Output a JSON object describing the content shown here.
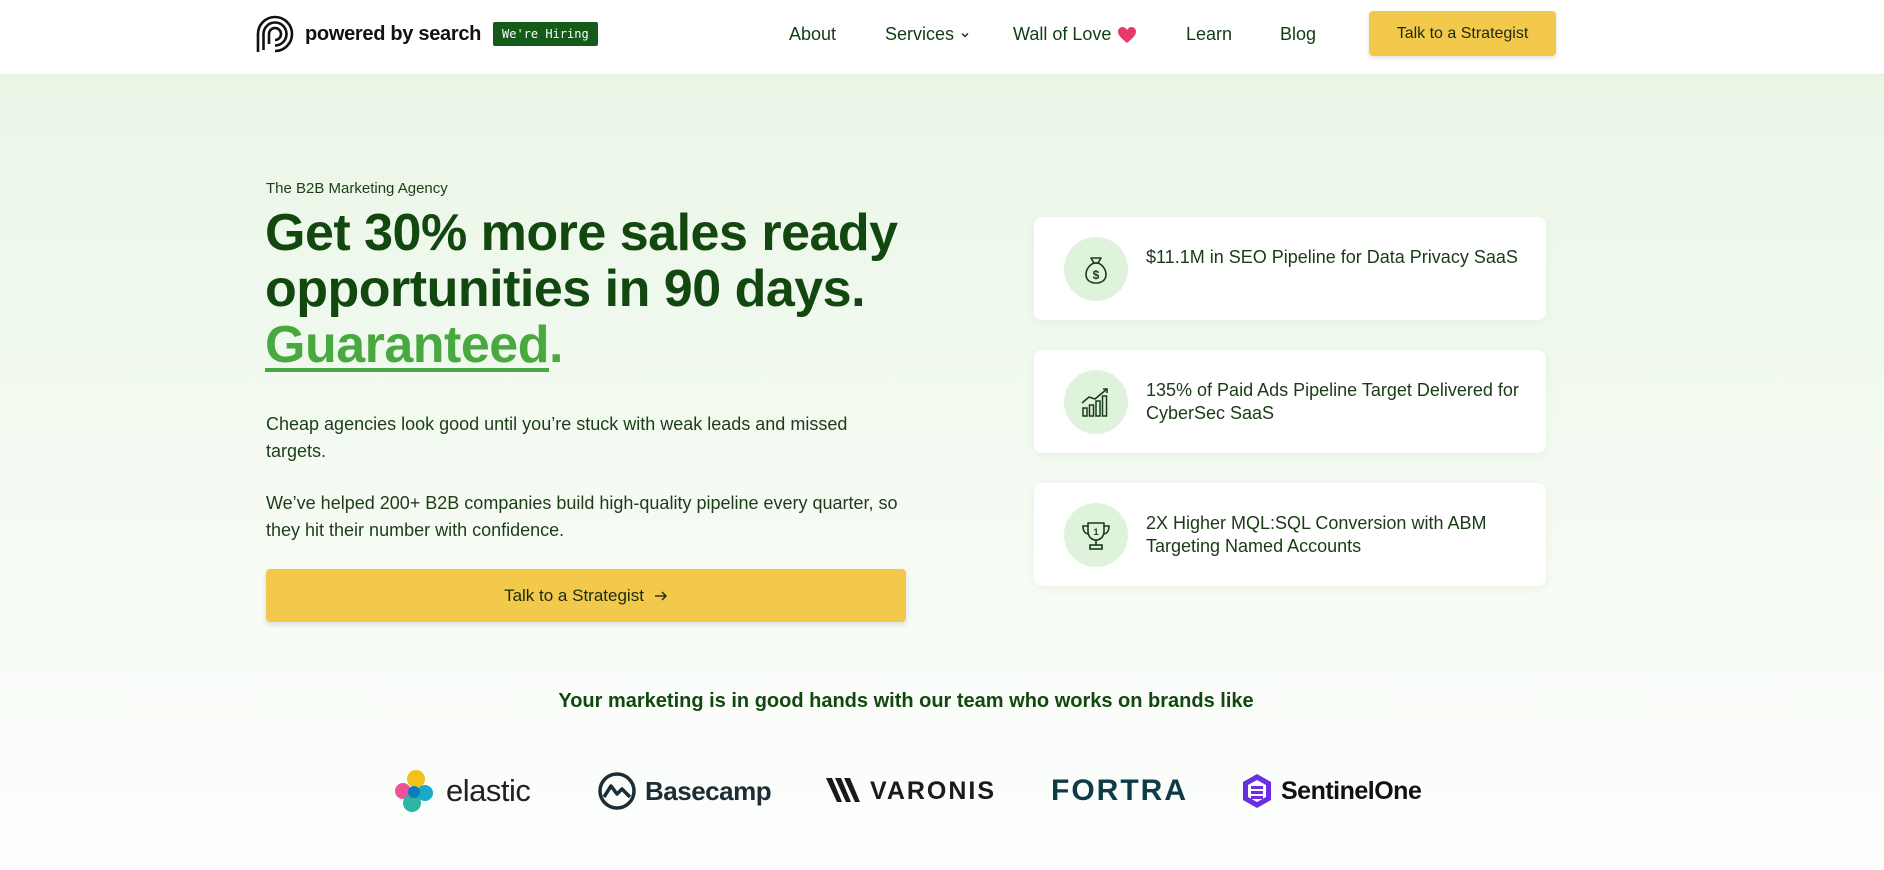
{
  "header": {
    "logo_text": "powered by search",
    "hiring_badge": "We're Hiring",
    "nav": {
      "about": "About",
      "services": "Services",
      "wall_of_love": "Wall of Love",
      "learn": "Learn",
      "blog": "Blog"
    },
    "cta_label": "Talk to a Strategist"
  },
  "hero": {
    "eyebrow": "The B2B Marketing Agency",
    "headline_line1": "Get 30% more sales ready",
    "headline_line2": "opportunities in 90 days.",
    "headline_accent": "Guaranteed",
    "headline_punct": ".",
    "paragraph_1": "Cheap agencies look good until you’re stuck with weak leads and missed targets.",
    "paragraph_2": "We’ve helped 200+ B2B companies build high-quality pipeline every quarter, so they hit their number with confidence.",
    "cta_label": "Talk to a Strategist"
  },
  "stats": [
    {
      "icon": "money-bag-icon",
      "text": "$11.1M in SEO Pipeline for Data Privacy SaaS"
    },
    {
      "icon": "growth-chart-icon",
      "text": "135% of Paid Ads Pipeline Target Delivered for CyberSec SaaS"
    },
    {
      "icon": "trophy-icon",
      "text": "2X Higher MQL:SQL Conversion with ABM Targeting Named Accounts"
    }
  ],
  "brands": {
    "heading": "Your marketing is in good hands with our team who works on brands like",
    "items": [
      "elastic",
      "Basecamp",
      "VARONIS",
      "FORTRA",
      "SentinelOne"
    ]
  },
  "colors": {
    "brand_green": "#12480f",
    "accent_green": "#4aa841",
    "cta_yellow": "#f3c94b",
    "heart_pink": "#e8386b"
  }
}
